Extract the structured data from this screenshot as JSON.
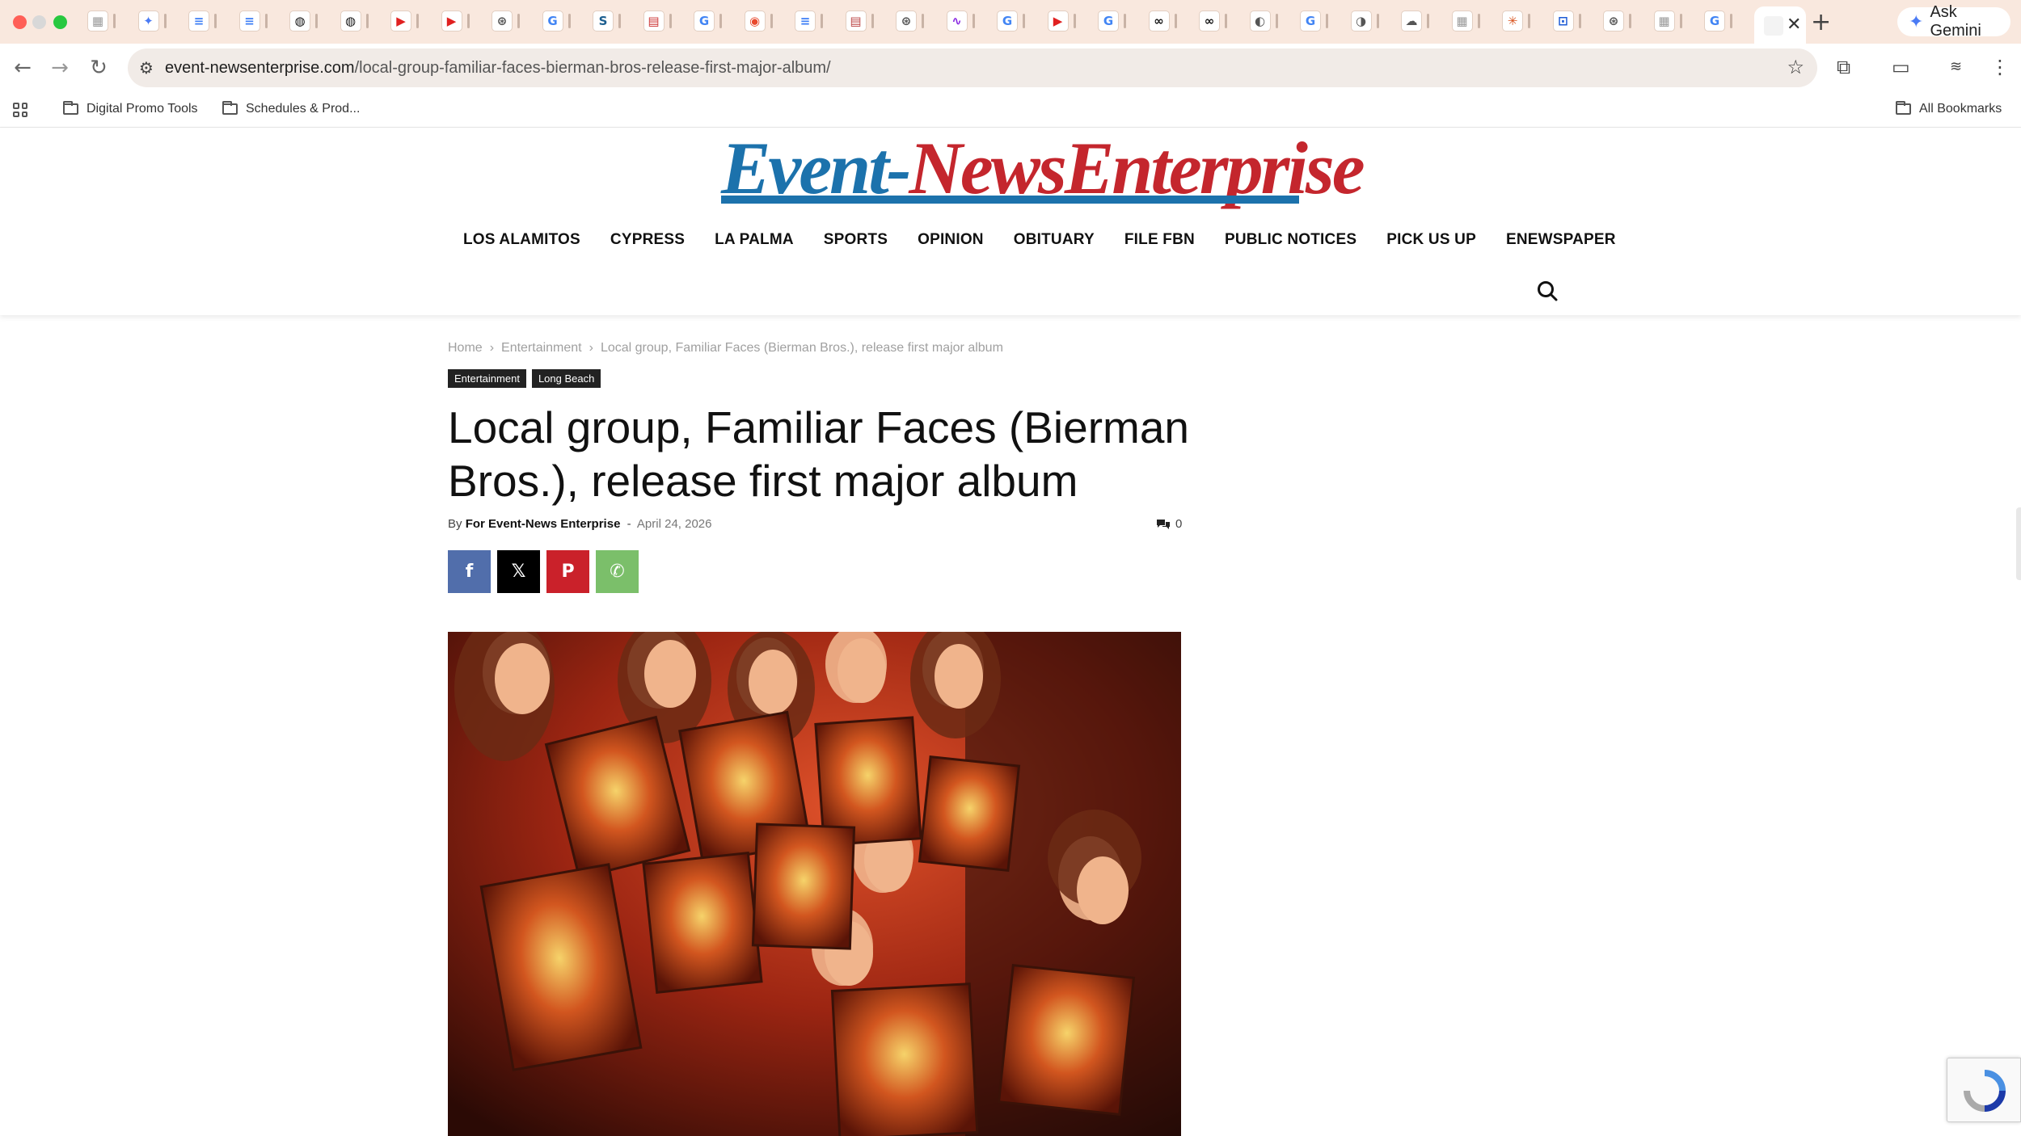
{
  "browser": {
    "url_domain": "event-newsenterprise.com",
    "url_path": "/local-group-familiar-faces-bierman-bros-release-first-major-album/",
    "gemini_label": "Ask Gemini",
    "tab_close_glyph": "✕",
    "new_tab_glyph": "+",
    "accent_color": "#f9e8de"
  },
  "bookmarks": {
    "items": [
      "Digital Promo Tools",
      "Schedules & Prod..."
    ],
    "all_label": "All Bookmarks"
  },
  "site": {
    "logo_part1": "Event-",
    "logo_part2": "NewsEnterprise",
    "logo_colors": {
      "blue": "#1c72ac",
      "red": "#c4262d"
    },
    "nav": [
      "LOS ALAMITOS",
      "CYPRESS",
      "LA PALMA",
      "SPORTS",
      "OPINION",
      "OBITUARY",
      "FILE FBN",
      "PUBLIC NOTICES",
      "PICK US UP",
      "ENEWSPAPER"
    ]
  },
  "article": {
    "breadcrumb": [
      "Home",
      "Entertainment",
      "Local group, Familiar Faces (Bierman Bros.), release first major album"
    ],
    "categories": [
      "Entertainment",
      "Long Beach"
    ],
    "title": "Local group, Familiar Faces (Bierman Bros.), release first major album",
    "by_label": "By",
    "author": "For Event-News Enterprise",
    "date_sep": "-",
    "date": "April 24, 2026",
    "comment_count": "0",
    "share": [
      {
        "icon": "facebook-icon",
        "glyph": "f",
        "color": "#516eab"
      },
      {
        "icon": "x-icon",
        "glyph": "𝕏",
        "color": "#000000"
      },
      {
        "icon": "pinterest-icon",
        "glyph": "P",
        "color": "#ca212a"
      },
      {
        "icon": "whatsapp-icon",
        "glyph": "✆",
        "color": "#7bbf6a"
      }
    ]
  }
}
